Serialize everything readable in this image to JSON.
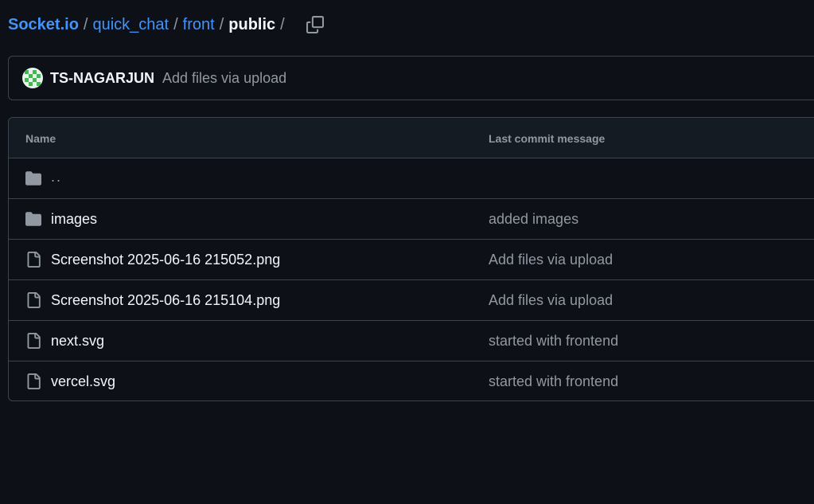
{
  "breadcrumb": {
    "items": [
      {
        "label": "Socket.io"
      },
      {
        "label": "quick_chat"
      },
      {
        "label": "front"
      }
    ],
    "current": "public",
    "separator": "/",
    "copy_icon": "copy-icon"
  },
  "latest_commit": {
    "author": "TS-NAGARJUN",
    "message": "Add files via upload"
  },
  "table": {
    "headers": {
      "name": "Name",
      "message": "Last commit message"
    },
    "rows": [
      {
        "name": "..",
        "icon": "folder-icon",
        "message": ""
      },
      {
        "name": "images",
        "icon": "folder-icon",
        "message": "added images"
      },
      {
        "name": "Screenshot 2025-06-16 215052.png",
        "icon": "file-icon",
        "message": "Add files via upload"
      },
      {
        "name": "Screenshot 2025-06-16 215104.png",
        "icon": "file-icon",
        "message": "Add files via upload"
      },
      {
        "name": "next.svg",
        "icon": "file-icon",
        "message": "started with frontend"
      },
      {
        "name": "vercel.svg",
        "icon": "file-icon",
        "message": "started with frontend"
      }
    ]
  },
  "colors": {
    "background": "#0d1117",
    "header_background": "#151b23",
    "border": "#3d444d",
    "link": "#4493f8",
    "muted_text": "#9198a1",
    "primary_text": "#f0f6fc",
    "avatar_green": "#3fb950"
  }
}
